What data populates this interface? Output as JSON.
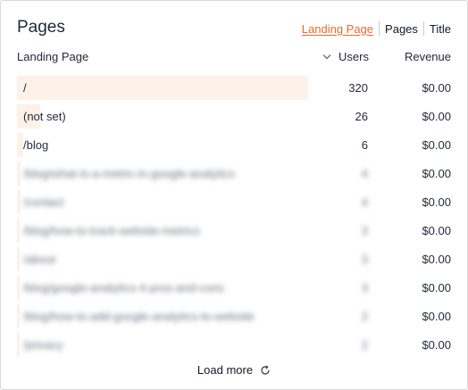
{
  "card": {
    "title": "Pages",
    "tabs": [
      {
        "label": "Landing Page",
        "active": true
      },
      {
        "label": "Pages",
        "active": false
      },
      {
        "label": "Title",
        "active": false
      }
    ]
  },
  "table": {
    "columns": {
      "landing": "Landing Page",
      "users": "Users",
      "revenue": "Revenue",
      "sort_icon": "chevron-down-icon"
    },
    "rows": [
      {
        "label": "/",
        "users": "320",
        "revenue": "$0.00",
        "share": 1.0,
        "blurred": false
      },
      {
        "label": "(not set)",
        "users": "26",
        "revenue": "$0.00",
        "share": 0.08,
        "blurred": false
      },
      {
        "label": "/blog",
        "users": "6",
        "revenue": "$0.00",
        "share": 0.02,
        "blurred": false
      },
      {
        "label": "/blog/what-is-a-metric-in-google-analytics",
        "users": "4",
        "revenue": "$0.00",
        "share": 0.012,
        "blurred": true
      },
      {
        "label": "/contact",
        "users": "4",
        "revenue": "$0.00",
        "share": 0.012,
        "blurred": true
      },
      {
        "label": "/blog/how-to-track-website-metrics",
        "users": "3",
        "revenue": "$0.00",
        "share": 0.009,
        "blurred": true
      },
      {
        "label": "/about",
        "users": "3",
        "revenue": "$0.00",
        "share": 0.009,
        "blurred": true
      },
      {
        "label": "/blog/google-analytics-4-pros-and-cons",
        "users": "3",
        "revenue": "$0.00",
        "share": 0.009,
        "blurred": true
      },
      {
        "label": "/blog/how-to-add-google-analytics-to-website",
        "users": "2",
        "revenue": "$0.00",
        "share": 0.006,
        "blurred": true
      },
      {
        "label": "/privacy",
        "users": "2",
        "revenue": "$0.00",
        "share": 0.006,
        "blurred": true
      }
    ]
  },
  "footer": {
    "load_more": "Load more",
    "refresh_icon": "refresh-icon"
  },
  "colors": {
    "accent": "#ea6a2a",
    "bar": "#fdf1e8",
    "text": "#1f2937"
  }
}
